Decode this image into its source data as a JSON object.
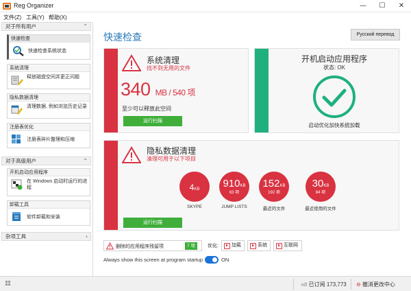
{
  "window": {
    "title": "Reg Organizer",
    "minimize": "—",
    "maximize": "☐",
    "close": "✕"
  },
  "menu": {
    "file": "文件(Z)",
    "tools": "工具(Y)",
    "help": "帮助(X)"
  },
  "sidebar": {
    "group_all_users": "对于所有用户",
    "group_advanced_users": "对于高级用户",
    "group_misc": "杂项工具",
    "items": [
      {
        "title": "快速检查",
        "text": "快速检查系统状态"
      },
      {
        "title": "系统清理",
        "text": "释放磁盘空间并更正问题"
      },
      {
        "title": "隐私数据清理",
        "text": "清理数据, 例如浏览历史记录"
      },
      {
        "title": "注册表优化",
        "text": "注册表碎片整理和压缩"
      },
      {
        "title": "开机启动应用程序",
        "text": "在 Windows 启动时运行的进程"
      },
      {
        "title": "卸载工具",
        "text": "软件卸载和安装"
      }
    ]
  },
  "main": {
    "title": "快速检查",
    "lang_button": "Русский перевод",
    "system_clean": {
      "heading": "系统清理",
      "subtitle": "找不到无用的文件",
      "big_number": "340",
      "big_unit": "MB / 540 项",
      "desc": "至少可以释放此空间",
      "button": "运行扫描"
    },
    "startup": {
      "heading": "开机启动应用程序",
      "status": "状态: OK",
      "desc": "启动优化加快系统加载"
    },
    "privacy": {
      "heading": "隐私数据清理",
      "subtitle": "清理可用于以下项目",
      "button": "运行扫描",
      "circles": [
        {
          "value": "4",
          "unit": "KB",
          "count": "",
          "label": "SKYPE"
        },
        {
          "value": "910",
          "unit": "KB",
          "count": "63 项",
          "label": "JUMP LISTS"
        },
        {
          "value": "152",
          "unit": "KB",
          "count": "192 项",
          "label": "最近的文件"
        },
        {
          "value": "30",
          "unit": "KB",
          "count": "84 项",
          "label": "最近使用的文件"
        }
      ]
    },
    "removed_apps": {
      "text": "删除的应用程序残留项",
      "count": "7 项"
    },
    "optimize": {
      "label": "优化:",
      "load": "加载",
      "system": "系统",
      "internet": "互联网"
    },
    "startup_toggle": {
      "text": "Always show this screen at program startup",
      "state": "ON"
    }
  },
  "statusbar": {
    "likes": "已订阅 173,773",
    "undo": "撤消更改中心"
  },
  "colors": {
    "red": "#d93241",
    "teal": "#1fb07e",
    "green": "#3fae3a",
    "blue": "#2a7ab9"
  }
}
